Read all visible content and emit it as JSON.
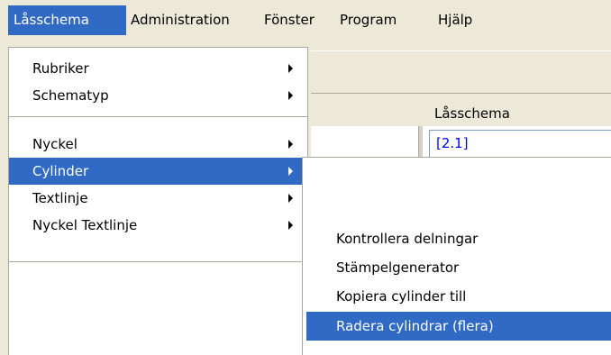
{
  "menubar": {
    "items": [
      "Låsschema",
      "Administration",
      "Fönster",
      "Program",
      "Hjälp"
    ]
  },
  "window": {
    "column_header": "Låsschema",
    "cell_value": "[2.1]"
  },
  "menu": {
    "items": [
      {
        "label": "Rubriker"
      },
      {
        "label": "Schematyp"
      },
      {
        "label": "Nyckel"
      },
      {
        "label": "Cylinder"
      },
      {
        "label": "Textlinje"
      },
      {
        "label": "Nyckel Textlinje"
      }
    ]
  },
  "submenu": {
    "items": [
      {
        "label": "Kontrollera delningar"
      },
      {
        "label": "Stämpelgenerator"
      },
      {
        "label": "Kopiera cylinder till"
      },
      {
        "label": "Radera cylindrar (flera)"
      }
    ]
  },
  "colors": {
    "highlight": "#316ac5",
    "face": "#ece9d8",
    "link": "#0000ff"
  }
}
